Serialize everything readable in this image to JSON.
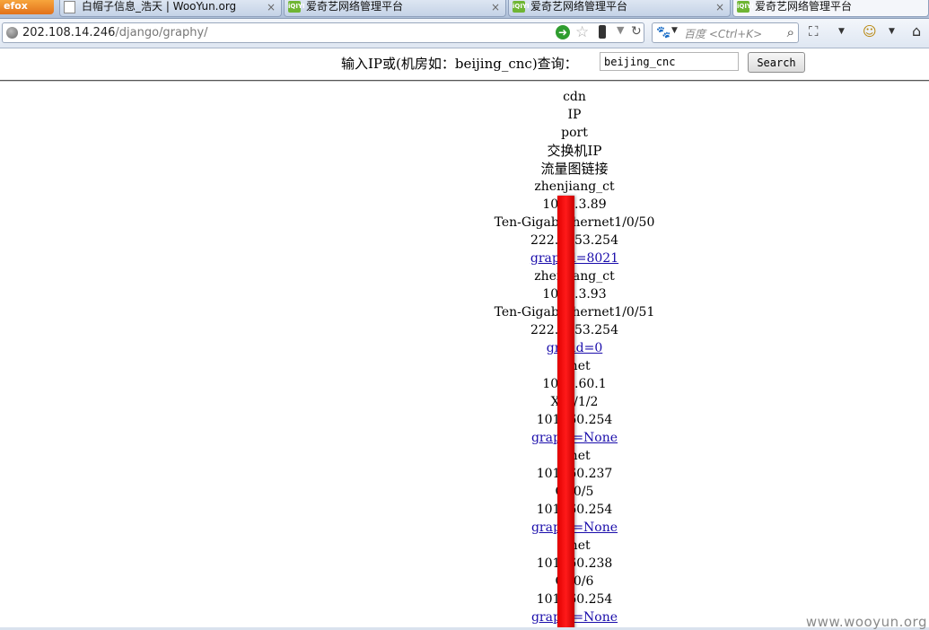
{
  "browser": {
    "menu_button": "efox",
    "tabs": [
      {
        "label": "白帽子信息_浩天 | WooYun.org",
        "icon": "blank-page-icon",
        "active": false
      },
      {
        "label": "爱奇艺网络管理平台",
        "icon": "iqiyi-icon",
        "active": false
      },
      {
        "label": "爱奇艺网络管理平台",
        "icon": "iqiyi-icon",
        "active": false
      },
      {
        "label": "爱奇艺网络管理平台",
        "icon": "iqiyi-icon",
        "active": true
      }
    ],
    "tab_close": "×",
    "url_host": "202.108.14.246",
    "url_path": "/django/graphy/",
    "search_placeholder": "百度 <Ctrl+K>",
    "iqiyi_icon_text": "iQIYI"
  },
  "query": {
    "label": "输入IP或(机房如：beijing_cnc)查询：",
    "value": "beijing_cnc",
    "button": "Search"
  },
  "headers": [
    "cdn",
    "IP",
    "port",
    "交换机IP",
    "流量图链接"
  ],
  "rows": [
    {
      "cdn": "zhenjiang_ct",
      "ip": "10.   0.3.89",
      "port": "Ten-Gigabi  thernet1/0/50",
      "switch_ip": "222.1   .53.254",
      "link": "grap   id=8021"
    },
    {
      "cdn": "zhen   iang_ct",
      "ip": "10.   0.3.93",
      "port": "Ten-Gigabi  thernet1/0/51",
      "switch_ip": "222.1   .53.254",
      "link": "gra    id=0"
    },
    {
      "cdn": "c   net",
      "ip": "101.   .60.1",
      "port": "XG   /1/2",
      "switch_ip": "101.   60.254",
      "link": "grap   d=None"
    },
    {
      "cdn": "c   net",
      "ip": "101.   60.237",
      "port": "G   /0/5",
      "switch_ip": "101.   60.254",
      "link": "grap   d=None"
    },
    {
      "cdn": "c   net",
      "ip": "101.   60.238",
      "port": "G   /0/6",
      "switch_ip": "101.   60.254",
      "link": "grap   d=None"
    }
  ],
  "watermark": "www.wooyun.org",
  "colors": {
    "link": "#1a0dab",
    "redaction": "#e00000"
  }
}
